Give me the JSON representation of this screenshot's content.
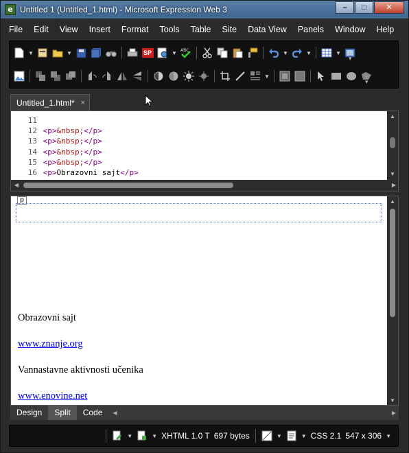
{
  "window": {
    "title": "Untitled 1 (Untitled_1.html) - Microsoft Expression Web 3",
    "app_icon_letter": "e",
    "controls": {
      "minimize": "–",
      "maximize": "□",
      "close": "✕"
    }
  },
  "menu": {
    "items": [
      "File",
      "Edit",
      "View",
      "Insert",
      "Format",
      "Tools",
      "Table",
      "Site",
      "Data View",
      "Panels",
      "Window",
      "Help"
    ]
  },
  "toolbar": {
    "sp_badge": "SP"
  },
  "document_tab": {
    "label": "Untitled_1.html*",
    "close": "×"
  },
  "code": {
    "lines": [
      {
        "num": "11",
        "open": "",
        "content": "",
        "close": ""
      },
      {
        "num": "12",
        "open": "<p>",
        "content": "&nbsp;",
        "close": "</p>"
      },
      {
        "num": "13",
        "open": "<p>",
        "content": "&nbsp;",
        "close": "</p>"
      },
      {
        "num": "14",
        "open": "<p>",
        "content": "&nbsp;",
        "close": "</p>"
      },
      {
        "num": "15",
        "open": "<p>",
        "content": "&nbsp;",
        "close": "</p>"
      },
      {
        "num": "16",
        "open": "<p>",
        "content": "Obrazovni sajt",
        "close": "</p>"
      }
    ]
  },
  "design": {
    "tag_chip": "p",
    "paragraphs": [
      {
        "text": "Obrazovni sajt",
        "link": false
      },
      {
        "text": "www.znanje.org",
        "link": true
      },
      {
        "text": "Vannastavne aktivnosti učenika",
        "link": false
      },
      {
        "text": "www.enovine.net",
        "link": true
      }
    ]
  },
  "view_tabs": {
    "design": "Design",
    "split": "Split",
    "code": "Code",
    "active": "Split"
  },
  "statusbar": {
    "doctype": "XHTML 1.0 T",
    "size": "697 bytes",
    "css": "CSS 2.1",
    "dimensions": "547 x 306"
  }
}
